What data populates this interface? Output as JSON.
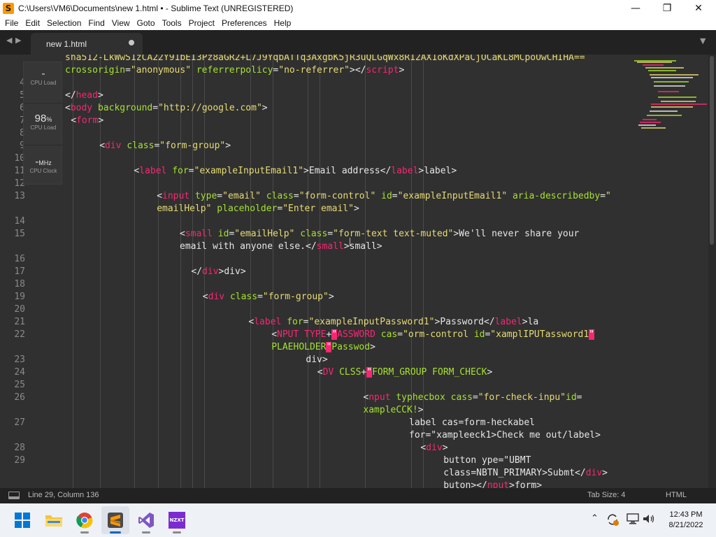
{
  "window": {
    "title": "C:\\Users\\VM6\\Documents\\new 1.html • - Sublime Text (UNREGISTERED)",
    "app_icon": "S",
    "controls": {
      "minimize": "—",
      "maximize": "❐",
      "close": "✕"
    }
  },
  "menu": [
    "File",
    "Edit",
    "Selection",
    "Find",
    "View",
    "Goto",
    "Tools",
    "Project",
    "Preferences",
    "Help"
  ],
  "tabs": {
    "nav_prev": "◀",
    "nav_next": "▶",
    "active_label": "new 1.html",
    "dropdown": "▼"
  },
  "editor": {
    "line_numbers": [
      {
        "n": "4",
        "row": 2
      },
      {
        "n": "5",
        "row": 3
      },
      {
        "n": "6",
        "row": 4
      },
      {
        "n": "7",
        "row": 5
      },
      {
        "n": "8",
        "row": 6
      },
      {
        "n": "9",
        "row": 7
      },
      {
        "n": "10",
        "row": 8
      },
      {
        "n": "11",
        "row": 9
      },
      {
        "n": "12",
        "row": 10
      },
      {
        "n": "13",
        "row": 11
      },
      {
        "n": "14",
        "row": 13
      },
      {
        "n": "15",
        "row": 14
      },
      {
        "n": "16",
        "row": 16
      },
      {
        "n": "17",
        "row": 17
      },
      {
        "n": "18",
        "row": 18
      },
      {
        "n": "19",
        "row": 19
      },
      {
        "n": "20",
        "row": 20
      },
      {
        "n": "21",
        "row": 21
      },
      {
        "n": "22",
        "row": 22
      },
      {
        "n": "23",
        "row": 24
      },
      {
        "n": "24",
        "row": 25
      },
      {
        "n": "25",
        "row": 26
      },
      {
        "n": "26",
        "row": 27
      },
      {
        "n": "27",
        "row": 29
      },
      {
        "n": "28",
        "row": 31
      },
      {
        "n": "29",
        "row": 32
      }
    ],
    "code_lines": [
      {
        "row": 0,
        "indent": 0,
        "partial": true,
        "segs": [
          [
            "s",
            "sha512-LkWwS1zCA22Y91bEI3Pz8aGR2+L7J9YqbATTq3AxgbK5jR3uQLGqWx8R12AX1oKdXPaCjOCaKL8MCpoOwCHIHA=="
          ]
        ]
      },
      {
        "row": 1,
        "indent": 0,
        "segs": [
          [
            "a",
            "crossorigin"
          ],
          [
            "p",
            "="
          ],
          [
            "s",
            "\"anonymous\""
          ],
          [
            "p",
            " "
          ],
          [
            "a",
            "referrerpolicy"
          ],
          [
            "p",
            "="
          ],
          [
            "s",
            "\"no-referrer\""
          ],
          [
            "p",
            "></"
          ],
          [
            "t",
            "script"
          ],
          [
            "p",
            ">"
          ]
        ]
      },
      {
        "row": 3,
        "indent": 0,
        "segs": [
          [
            "p",
            "</"
          ],
          [
            "t",
            "head"
          ],
          [
            "p",
            ">"
          ]
        ]
      },
      {
        "row": 4,
        "indent": 0,
        "segs": [
          [
            "p",
            "<"
          ],
          [
            "t",
            "body"
          ],
          [
            "p",
            " "
          ],
          [
            "a",
            "background"
          ],
          [
            "p",
            "="
          ],
          [
            "s",
            "\"http://google.com\""
          ],
          [
            "p",
            ">"
          ]
        ]
      },
      {
        "row": 5,
        "indent": 1,
        "segs": [
          [
            "p",
            "<"
          ],
          [
            "t",
            "form"
          ],
          [
            "p",
            ">"
          ]
        ]
      },
      {
        "row": 7,
        "indent": 6,
        "segs": [
          [
            "p",
            "<"
          ],
          [
            "t",
            "div"
          ],
          [
            "p",
            " "
          ],
          [
            "a",
            "class"
          ],
          [
            "p",
            "="
          ],
          [
            "s",
            "\"form-group\""
          ],
          [
            "p",
            ">"
          ]
        ]
      },
      {
        "row": 9,
        "indent": 12,
        "segs": [
          [
            "p",
            "<"
          ],
          [
            "t",
            "label"
          ],
          [
            "p",
            " "
          ],
          [
            "a",
            "for"
          ],
          [
            "p",
            "="
          ],
          [
            "s",
            "\"exampleInputEmail1\""
          ],
          [
            "p",
            ">Email address</"
          ],
          [
            "t",
            "label"
          ],
          [
            "p",
            ">label>"
          ]
        ]
      },
      {
        "row": 11,
        "indent": 16,
        "segs": [
          [
            "p",
            "<"
          ],
          [
            "t",
            "input"
          ],
          [
            "p",
            " "
          ],
          [
            "a",
            "type"
          ],
          [
            "p",
            "="
          ],
          [
            "s",
            "\"email\""
          ],
          [
            "p",
            " "
          ],
          [
            "a",
            "class"
          ],
          [
            "p",
            "="
          ],
          [
            "s",
            "\"form-control\""
          ],
          [
            "p",
            " "
          ],
          [
            "a",
            "id"
          ],
          [
            "p",
            "="
          ],
          [
            "s",
            "\"exampleInputEmail1\""
          ],
          [
            "p",
            " "
          ],
          [
            "a",
            "aria-describedby"
          ],
          [
            "p",
            "="
          ],
          [
            "s",
            "\""
          ]
        ]
      },
      {
        "row": 12,
        "indent": 16,
        "segs": [
          [
            "s",
            "emailHelp\""
          ],
          [
            "p",
            " "
          ],
          [
            "a",
            "placeholder"
          ],
          [
            "p",
            "="
          ],
          [
            "s",
            "\"Enter email\""
          ],
          [
            "p",
            ">"
          ]
        ]
      },
      {
        "row": 14,
        "indent": 20,
        "segs": [
          [
            "p",
            "<"
          ],
          [
            "t",
            "small"
          ],
          [
            "p",
            " "
          ],
          [
            "a",
            "id"
          ],
          [
            "p",
            "="
          ],
          [
            "s",
            "\"emailHelp\""
          ],
          [
            "p",
            " "
          ],
          [
            "a",
            "class"
          ],
          [
            "p",
            "="
          ],
          [
            "s",
            "\"form-text text-muted\""
          ],
          [
            "p",
            ">We'll never share your"
          ]
        ]
      },
      {
        "row": 15,
        "indent": 20,
        "segs": [
          [
            "p",
            "email with anyone else.</"
          ],
          [
            "t",
            "small"
          ],
          [
            "p",
            ">small>"
          ]
        ]
      },
      {
        "row": 17,
        "indent": 22,
        "segs": [
          [
            "p",
            "</"
          ],
          [
            "t",
            "div"
          ],
          [
            "p",
            ">div>"
          ]
        ]
      },
      {
        "row": 19,
        "indent": 24,
        "segs": [
          [
            "p",
            "<"
          ],
          [
            "t",
            "div"
          ],
          [
            "p",
            " "
          ],
          [
            "a",
            "class"
          ],
          [
            "p",
            "="
          ],
          [
            "s",
            "\"form-group\""
          ],
          [
            "p",
            ">"
          ]
        ]
      },
      {
        "row": 21,
        "indent": 32,
        "segs": [
          [
            "p",
            "<"
          ],
          [
            "t",
            "label"
          ],
          [
            "p",
            " "
          ],
          [
            "a",
            "for"
          ],
          [
            "p",
            "="
          ],
          [
            "s",
            "\"exampleInputPassword1\""
          ],
          [
            "p",
            ">Password</"
          ],
          [
            "t",
            "label"
          ],
          [
            "p",
            ">la"
          ]
        ]
      },
      {
        "row": 22,
        "indent": 36,
        "segs": [
          [
            "p",
            "<"
          ],
          [
            "t",
            "NPUT TYPE"
          ],
          [
            "p",
            "+"
          ],
          [
            "err",
            "\""
          ],
          [
            "t",
            "ASSWORD"
          ],
          [
            "p",
            " "
          ],
          [
            "a",
            "cas"
          ],
          [
            "p",
            "="
          ],
          [
            "s",
            "\"orm-control"
          ],
          [
            "p",
            " "
          ],
          [
            "a",
            "id"
          ],
          [
            "p",
            "="
          ],
          [
            "s",
            "\"xamplIPUTassword1"
          ],
          [
            "err",
            "\""
          ]
        ]
      },
      {
        "row": 23,
        "indent": 36,
        "segs": [
          [
            "a",
            "PLAEHOLDER"
          ],
          [
            "err",
            "\""
          ],
          [
            "a",
            "Passwod"
          ],
          [
            "p",
            ">"
          ]
        ]
      },
      {
        "row": 24,
        "indent": 42,
        "segs": [
          [
            "p",
            "div>"
          ]
        ]
      },
      {
        "row": 25,
        "indent": 44,
        "segs": [
          [
            "p",
            "<"
          ],
          [
            "t",
            "DV"
          ],
          [
            "p",
            " "
          ],
          [
            "a",
            "CLSS"
          ],
          [
            "p",
            "+"
          ],
          [
            "err",
            "\""
          ],
          [
            "a",
            "FORM_GROUP FORM_CHECK"
          ],
          [
            "p",
            ">"
          ]
        ]
      },
      {
        "row": 27,
        "indent": 52,
        "segs": [
          [
            "p",
            "<"
          ],
          [
            "t",
            "nput"
          ],
          [
            "p",
            " "
          ],
          [
            "a",
            "typhecbox"
          ],
          [
            "p",
            " "
          ],
          [
            "a",
            "cass"
          ],
          [
            "p",
            "="
          ],
          [
            "s",
            "\"for-check-inpu\""
          ],
          [
            "a",
            "id"
          ],
          [
            "p",
            "="
          ]
        ]
      },
      {
        "row": 28,
        "indent": 52,
        "segs": [
          [
            "a",
            "xampleCCK!"
          ],
          [
            "p",
            ">"
          ]
        ]
      },
      {
        "row": 29,
        "indent": 60,
        "segs": [
          [
            "p",
            "label cas=form-heckabel"
          ]
        ]
      },
      {
        "row": 30,
        "indent": 60,
        "segs": [
          [
            "p",
            "for=\"xampleeck1>Check me out/label>"
          ]
        ]
      },
      {
        "row": 31,
        "indent": 62,
        "segs": [
          [
            "p",
            "<"
          ],
          [
            "t",
            "div"
          ],
          [
            "p",
            ">"
          ]
        ]
      },
      {
        "row": 32,
        "indent": 66,
        "segs": [
          [
            "p",
            "button ype=\"UBMT"
          ]
        ]
      },
      {
        "row": 33,
        "indent": 66,
        "segs": [
          [
            "p",
            "class=NBTN_PRIMARY>Submt</"
          ],
          [
            "t",
            "div"
          ],
          [
            "p",
            ">"
          ]
        ]
      },
      {
        "row": 34,
        "indent": 66,
        "segs": [
          [
            "p",
            "buton></"
          ],
          [
            "t",
            "nput"
          ],
          [
            "p",
            ">form>"
          ]
        ]
      }
    ]
  },
  "widget": {
    "cpu_load_1": {
      "value": "-",
      "label": "CPU Load"
    },
    "cpu_load_2": {
      "value": "98",
      "unit": "%",
      "label": "CPU Load"
    },
    "cpu_clock": {
      "value": "-",
      "unit": "MHz",
      "label": "CPU Clock"
    }
  },
  "status": {
    "position": "Line 29, Column 136",
    "tab_size": "Tab Size: 4",
    "syntax": "HTML"
  },
  "taskbar": {
    "apps": [
      "windows-start",
      "file-explorer",
      "chrome",
      "sublime-text",
      "visual-studio",
      "nzxt-cam"
    ],
    "nzxt_label": "NZXT",
    "tray": {
      "chevron": "^",
      "time": "12:43 PM",
      "date": "8/21/2022"
    }
  },
  "colors": {
    "tag": "#f92672",
    "attribute": "#a6e22e",
    "string": "#e6db74",
    "text": "#e6e6e6",
    "editor_bg": "#303030",
    "chrome_bg": "#222222"
  }
}
